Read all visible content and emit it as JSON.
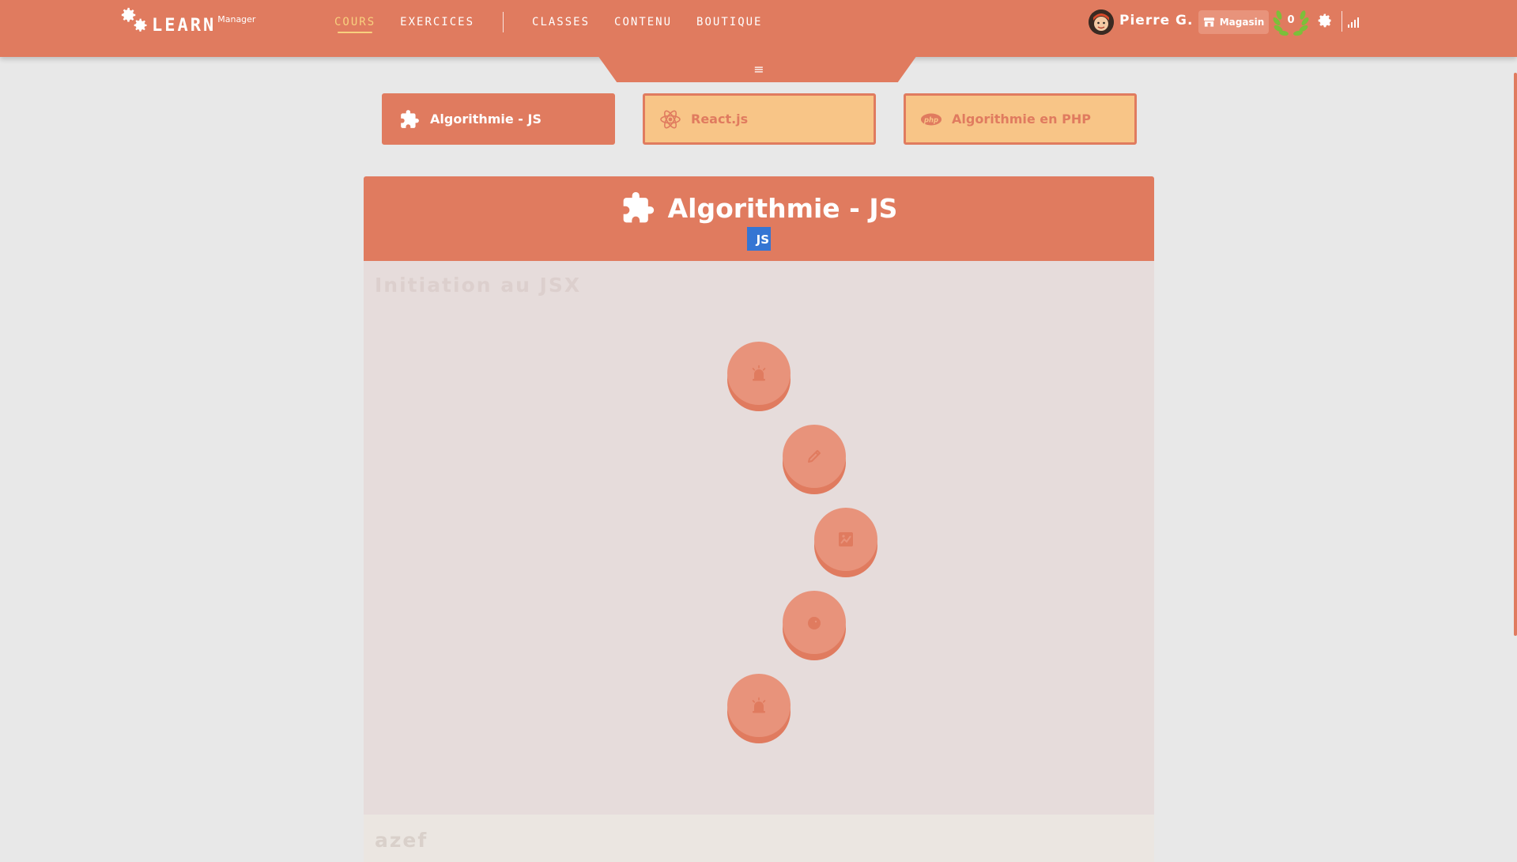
{
  "app": {
    "logo_text": "LEARN",
    "logo_sub": "Manager"
  },
  "nav": {
    "items": [
      {
        "label": "COURS",
        "active": true
      },
      {
        "label": "EXERCICES",
        "active": false
      },
      {
        "label": "CLASSES",
        "active": false
      },
      {
        "label": "CONTENU",
        "active": false
      },
      {
        "label": "BOUTIQUE",
        "active": false
      }
    ],
    "menu_icon": "≡"
  },
  "user": {
    "name": "Pierre G.",
    "shop_label": "Magasin",
    "laurel_count": "0"
  },
  "course_tabs": [
    {
      "label": "Algorithmie - JS",
      "icon": "puzzle-icon",
      "active": true
    },
    {
      "label": "React.js",
      "icon": "react-icon",
      "active": false
    },
    {
      "label": "Algorithmie en PHP",
      "icon": "php-icon",
      "active": false
    }
  ],
  "course": {
    "title": "Algorithmie - JS",
    "badge": "JS",
    "sections": [
      {
        "title": "Initiation au JSX",
        "nodes": [
          "alarm-icon",
          "pencil-icon",
          "chart-icon",
          "chick-icon",
          "alarm-icon"
        ]
      },
      {
        "title": "azef",
        "nodes": []
      }
    ]
  },
  "colors": {
    "accent": "#e07b5f",
    "accent_light": "#e8937b",
    "tab_inactive": "#f8c587",
    "nav_active": "#f8d07e",
    "js_badge": "#3575d3",
    "background": "#e8e8e8"
  }
}
